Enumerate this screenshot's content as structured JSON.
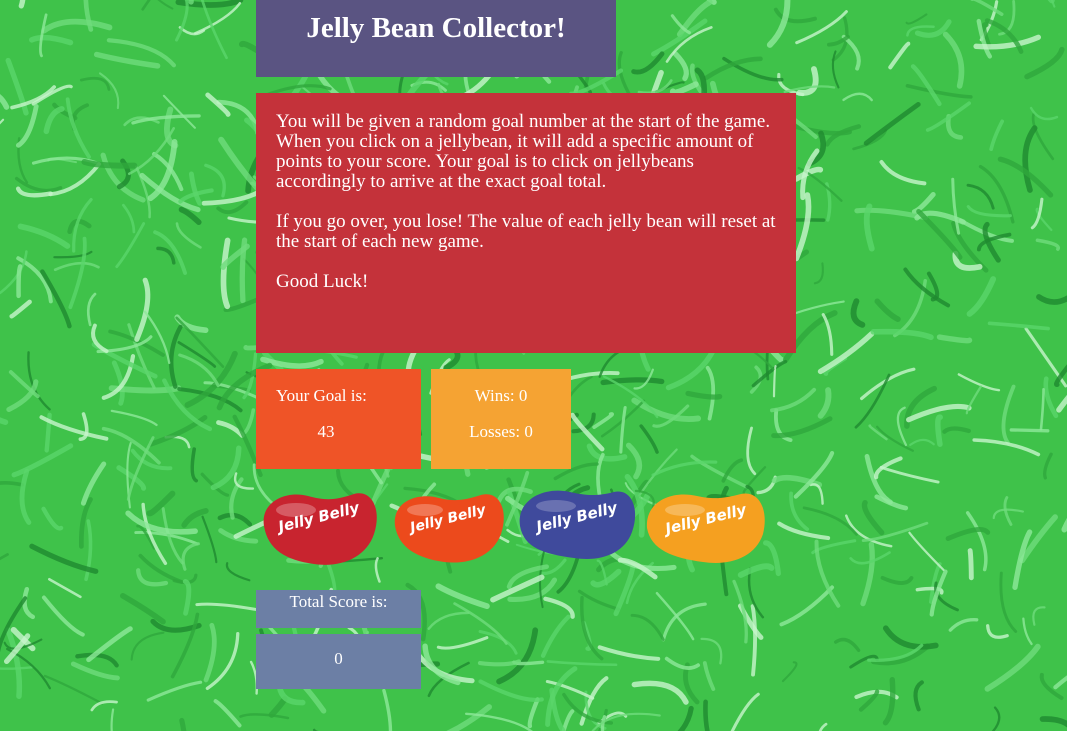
{
  "header": {
    "title": "Jelly Bean Collector!"
  },
  "instructions": {
    "paragraphs": [
      "You will be given a random goal number at the start of the game. When you click on a jellybean, it will add a specific amount of points to your score. Your goal is to click on jellybeans accordingly to arrive at the exact goal total.",
      "If you go over, you lose! The value of each jelly bean will reset at the start of each new game.",
      "Good Luck!"
    ]
  },
  "goal": {
    "label": "Your Goal is:",
    "value": "43"
  },
  "stats": {
    "wins": "Wins: 0",
    "losses": "Losses: 0"
  },
  "beans": [
    {
      "name": "red",
      "color": "#c8242f",
      "brand_text": "Jelly Belly"
    },
    {
      "name": "orange",
      "color": "#ec4a1c",
      "brand_text": "Jelly Belly"
    },
    {
      "name": "blue",
      "color": "#3f4a9c",
      "brand_text": "Jelly Belly"
    },
    {
      "name": "yellow-orange",
      "color": "#f5a020",
      "brand_text": "Jelly Belly"
    }
  ],
  "score": {
    "label": "Total Score is:",
    "value": "0"
  },
  "colors": {
    "title_bg": "#5a5482",
    "instructions_bg": "#c4323a",
    "goal_bg": "#ef5427",
    "stats_bg": "#f5a333",
    "score_bg": "#6c7fa5",
    "grass": "#3fc24a"
  }
}
